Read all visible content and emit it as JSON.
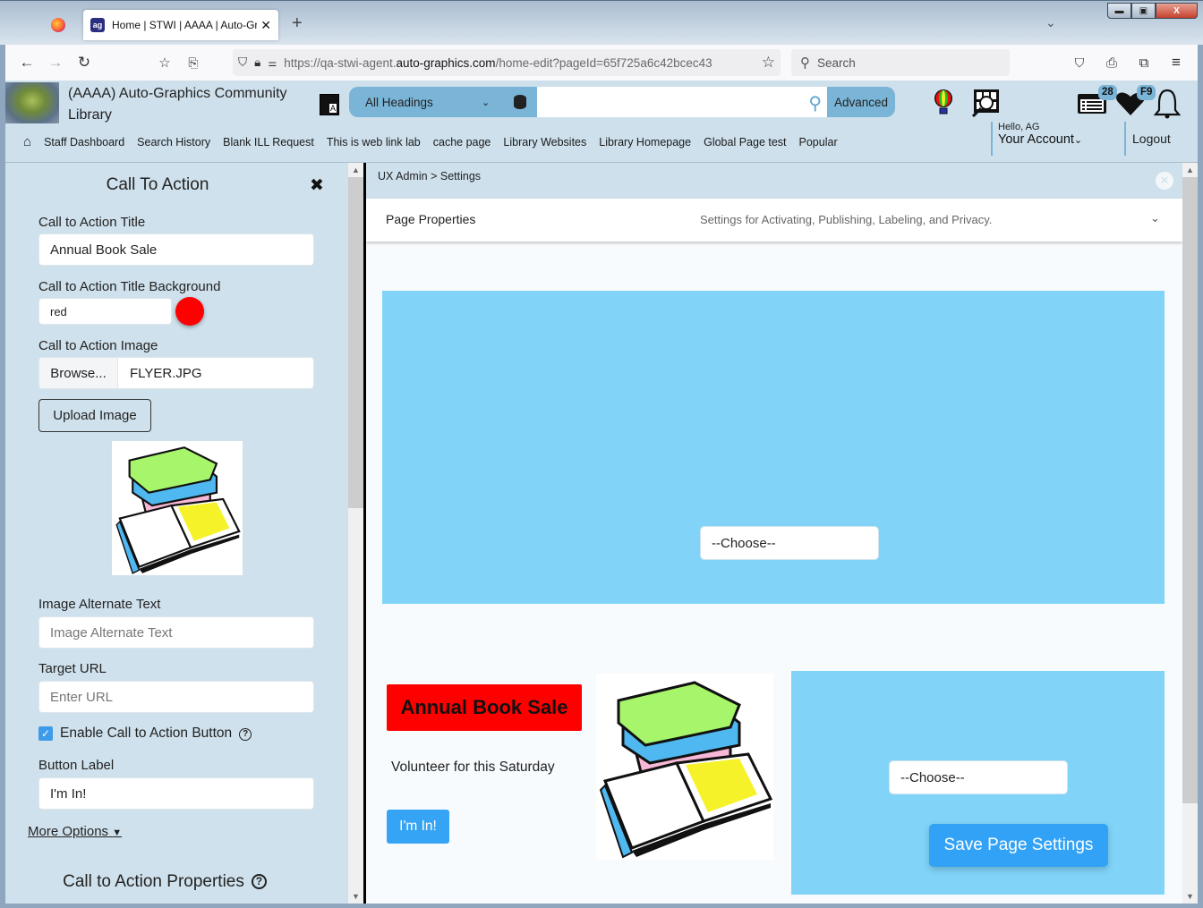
{
  "browser": {
    "tab_title": "Home | STWI | AAAA | Auto-Gra",
    "tab_favicon": "ag",
    "url_prefix": "https://qa-stwi-agent.",
    "url_domain": "auto-graphics.com",
    "url_suffix": "/home-edit?pageId=65f725a6c42bcec43",
    "search_placeholder": "Search",
    "new_tab": "+",
    "tab_close": "✕",
    "tab_list": "⌄",
    "window": {
      "minimize": "▬",
      "restore": "▣",
      "close": "X"
    },
    "nav": {
      "back": "←",
      "forward": "→",
      "reload": "↻"
    }
  },
  "header": {
    "library_name": "(AAAA) Auto-Graphics Community Library",
    "translate_label": "A",
    "search": {
      "scope": "All Headings",
      "query": "",
      "advanced_label": "Advanced"
    },
    "badges": {
      "list": "28",
      "favorites": "F9"
    },
    "menu": [
      "Staff Dashboard",
      "Search History",
      "Blank ILL Request",
      "This is web link lab",
      "cache page",
      "Library Websites",
      "Library Homepage",
      "Global Page test",
      "Popular"
    ],
    "greeting": "Hello, AG",
    "account_label": "Your Account",
    "logout_label": "Logout"
  },
  "left_panel": {
    "title": "Call To Action",
    "close": "✖",
    "fields": {
      "title_label": "Call to Action Title",
      "title_value": "Annual Book Sale",
      "bg_label": "Call to Action Title Background",
      "bg_value": "red",
      "bg_color": "#ff0000",
      "image_label": "Call to Action Image",
      "browse_label": "Browse...",
      "file_name": "FLYER.JPG",
      "upload_label": "Upload Image",
      "alt_label": "Image Alternate Text",
      "alt_placeholder": "Image Alternate Text",
      "url_label": "Target URL",
      "url_placeholder": "Enter URL",
      "enable_button_label": "Enable Call to Action Button",
      "enable_button_checked": true,
      "button_label_label": "Button Label",
      "button_label_value": "I'm In!"
    },
    "more_options": "More Options",
    "properties_title": "Call to Action Properties"
  },
  "content": {
    "breadcrumb": [
      "UX Admin",
      "Settings"
    ],
    "breadcrumb_sep": ">",
    "page_properties": {
      "title": "Page Properties",
      "description": "Settings for Activating, Publishing, Labeling, and Privacy."
    },
    "choose_placeholder": "--Choose--",
    "cta_preview": {
      "title": "Annual Book Sale",
      "title_bg": "#ff0000",
      "description": "Volunteer for this Saturday",
      "button": "I'm In!"
    },
    "save_label": "Save Page Settings"
  },
  "colors": {
    "header_bg": "#cde0ec",
    "accent": "#7ab4d6",
    "banner": "#81d4f8",
    "button": "#32a2f6"
  }
}
